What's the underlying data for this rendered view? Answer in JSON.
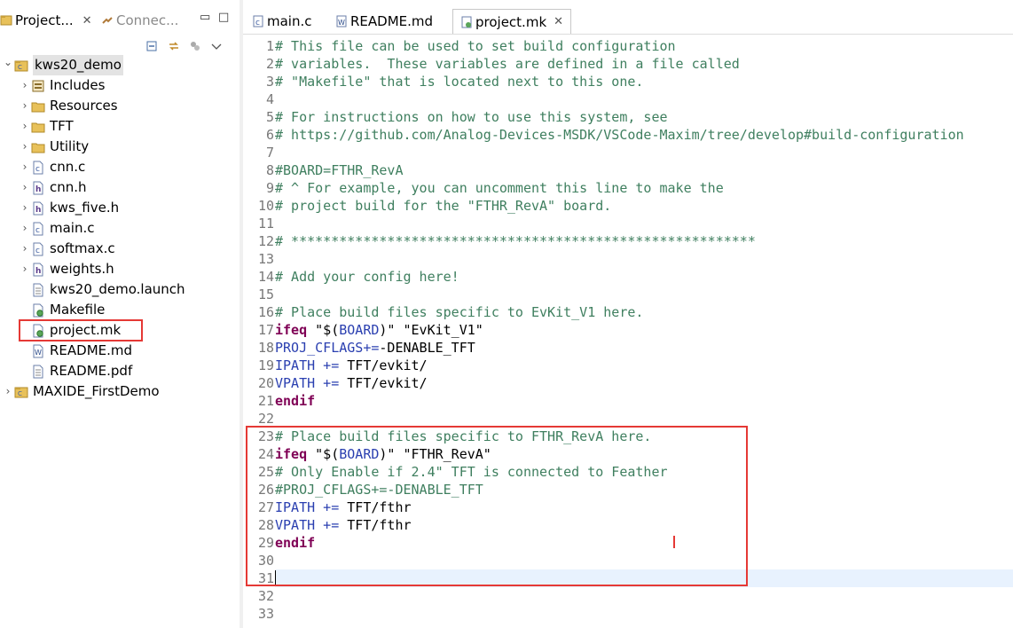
{
  "explorer": {
    "tabs": [
      {
        "label": "Project...",
        "close": "✕"
      },
      {
        "label": "Connec..."
      }
    ],
    "tree": [
      {
        "label": "kws20_demo",
        "type": "project",
        "expanded": true
      },
      {
        "label": "Includes",
        "type": "includes"
      },
      {
        "label": "Resources",
        "type": "folder"
      },
      {
        "label": "TFT",
        "type": "folder"
      },
      {
        "label": "Utility",
        "type": "folder"
      },
      {
        "label": "cnn.c",
        "type": "c-file"
      },
      {
        "label": "cnn.h",
        "type": "h-file"
      },
      {
        "label": "kws_five.h",
        "type": "h-file"
      },
      {
        "label": "main.c",
        "type": "c-file"
      },
      {
        "label": "softmax.c",
        "type": "c-file"
      },
      {
        "label": "weights.h",
        "type": "h-file"
      },
      {
        "label": "kws20_demo.launch",
        "type": "launch-file"
      },
      {
        "label": "Makefile",
        "type": "make-file"
      },
      {
        "label": "project.mk",
        "type": "make-file"
      },
      {
        "label": "README.md",
        "type": "md-file"
      },
      {
        "label": "README.pdf",
        "type": "pdf-file"
      },
      {
        "label": "MAXIDE_FirstDemo",
        "type": "project",
        "expanded": false
      }
    ]
  },
  "editor": {
    "tabs": [
      {
        "label": "main.c",
        "active": false
      },
      {
        "label": "README.md",
        "active": false
      },
      {
        "label": "project.mk",
        "active": true,
        "close": "✕"
      }
    ],
    "lines": [
      [
        {
          "t": "# This file can be used to set build configuration",
          "c": "comment"
        }
      ],
      [
        {
          "t": "# variables.  These variables are defined in a file called",
          "c": "comment"
        }
      ],
      [
        {
          "t": "# \"Makefile\" that is located next to this one.",
          "c": "comment"
        }
      ],
      [],
      [
        {
          "t": "# For instructions on how to use this system, see",
          "c": "comment"
        }
      ],
      [
        {
          "t": "# https://github.com/Analog-Devices-MSDK/VSCode-Maxim/tree/develop#build-configuration",
          "c": "comment"
        }
      ],
      [],
      [
        {
          "t": "#BOARD=FTHR_RevA",
          "c": "comment"
        }
      ],
      [
        {
          "t": "# ^ For example, you can uncomment this line to make the",
          "c": "comment"
        }
      ],
      [
        {
          "t": "# project build for the \"FTHR_RevA\" board.",
          "c": "comment"
        }
      ],
      [],
      [
        {
          "t": "# **********************************************************",
          "c": "comment"
        }
      ],
      [],
      [
        {
          "t": "# Add your config here!",
          "c": "comment"
        }
      ],
      [],
      [
        {
          "t": "# Place build files specific to EvKit_V1 here.",
          "c": "comment"
        }
      ],
      [
        {
          "t": "ifeq",
          "c": "kw"
        },
        {
          "t": " \"$(",
          "c": "str"
        },
        {
          "t": "BOARD",
          "c": "var"
        },
        {
          "t": ")\" \"EvKit_V1\"",
          "c": "str"
        }
      ],
      [
        {
          "t": "PROJ_CFLAGS",
          "c": "var"
        },
        {
          "t": "+=",
          "c": "var"
        },
        {
          "t": "-DENABLE_TFT",
          "c": "str"
        }
      ],
      [
        {
          "t": "IPATH",
          "c": "var"
        },
        {
          "t": " += ",
          "c": "var"
        },
        {
          "t": "TFT/evkit/",
          "c": "str"
        }
      ],
      [
        {
          "t": "VPATH",
          "c": "var"
        },
        {
          "t": " += ",
          "c": "var"
        },
        {
          "t": "TFT/evkit/",
          "c": "str"
        }
      ],
      [
        {
          "t": "endif",
          "c": "kw"
        }
      ],
      [],
      [
        {
          "t": "# Place build files specific to FTHR_RevA here.",
          "c": "comment"
        }
      ],
      [
        {
          "t": "ifeq",
          "c": "kw"
        },
        {
          "t": " \"$(",
          "c": "str"
        },
        {
          "t": "BOARD",
          "c": "var"
        },
        {
          "t": ")\" \"FTHR_RevA\"",
          "c": "str"
        }
      ],
      [
        {
          "t": "# Only Enable if 2.4\" TFT is connected to Feather",
          "c": "comment"
        }
      ],
      [
        {
          "t": "#PROJ_CFLAGS+=-DENABLE_TFT",
          "c": "comment"
        }
      ],
      [
        {
          "t": "IPATH",
          "c": "var"
        },
        {
          "t": " += ",
          "c": "var"
        },
        {
          "t": "TFT/fthr",
          "c": "str"
        }
      ],
      [
        {
          "t": "VPATH",
          "c": "var"
        },
        {
          "t": " += ",
          "c": "var"
        },
        {
          "t": "TFT/fthr",
          "c": "str"
        }
      ],
      [
        {
          "t": "endif",
          "c": "kw"
        }
      ],
      [],
      [],
      [],
      []
    ],
    "current_line": 31
  }
}
